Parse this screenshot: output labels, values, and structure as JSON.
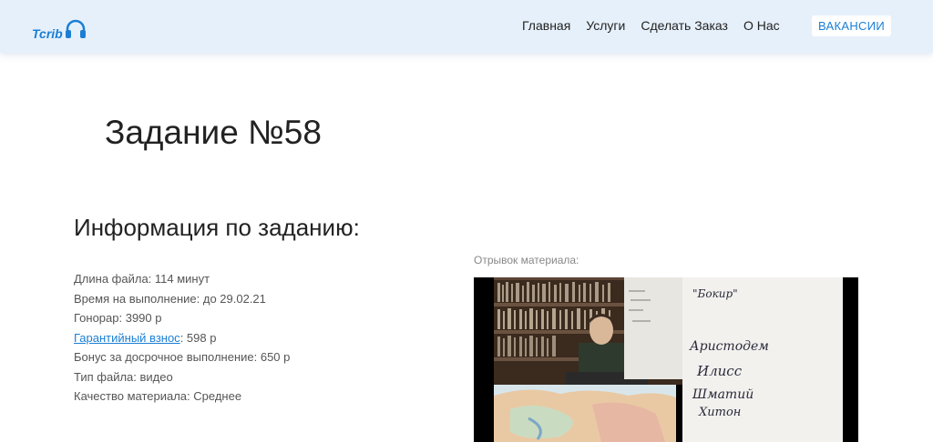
{
  "header": {
    "logo_text": "Tcrib",
    "nav": [
      "Главная",
      "Услуги",
      "Сделать Заказ",
      "О Нас"
    ],
    "vacancy_button": "ВАКАНСИИ"
  },
  "page": {
    "title": "Задание №58",
    "info_title": "Информация по заданию:"
  },
  "info": {
    "duration": "Длина файла: 114 минут",
    "deadline": "Время на выполнение: до 29.02.21",
    "fee": "Гонорар: 3990 р",
    "deposit_link": "Гарантийный взнос",
    "deposit_value": ": 598 р",
    "bonus": "Бонус за досрочное выполнение: 650 р",
    "file_type": "Тип файла: видео",
    "quality": "Качество материала: Среднее"
  },
  "excerpt": {
    "label": "Отрывок материала:",
    "board_text": [
      "\"Бокир\"",
      "Аристодем",
      "Илисс",
      "Шматий",
      "Хитон"
    ]
  },
  "colors": {
    "accent": "#1a7fd4",
    "header_bg": "#e6f0fb"
  }
}
